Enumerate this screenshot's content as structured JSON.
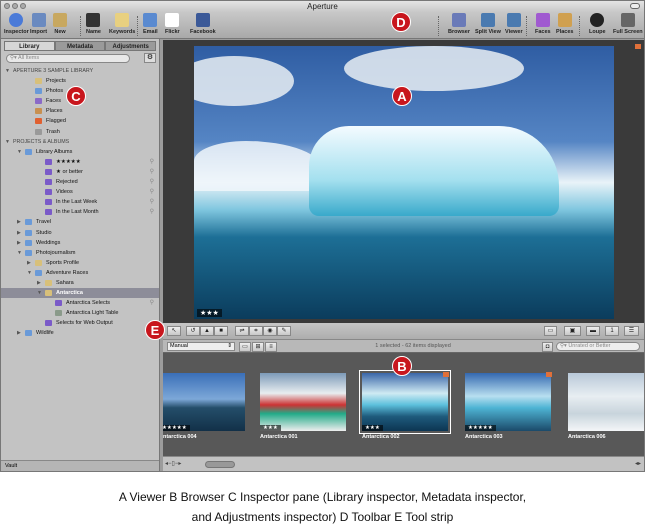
{
  "window": {
    "title": "Aperture"
  },
  "toolbar": {
    "left": [
      {
        "label": "Inspector",
        "icon": "info-icon"
      },
      {
        "label": "Import",
        "icon": "import-arrow-icon"
      },
      {
        "label": "New",
        "icon": "new-project-icon"
      },
      {
        "label": "Name",
        "icon": "name-stamp-icon"
      },
      {
        "label": "Keywords",
        "icon": "keyword-tag-icon"
      },
      {
        "label": "Email",
        "icon": "email-icon"
      },
      {
        "label": "Flickr",
        "icon": "flickr-icon"
      },
      {
        "label": "Facebook",
        "icon": "facebook-icon"
      }
    ],
    "right": [
      {
        "label": "Browser",
        "icon": "grid-icon"
      },
      {
        "label": "Split View",
        "icon": "split-view-icon"
      },
      {
        "label": "Viewer",
        "icon": "viewer-icon"
      },
      {
        "label": "Faces",
        "icon": "faces-icon"
      },
      {
        "label": "Places",
        "icon": "map-icon"
      },
      {
        "label": "Loupe",
        "icon": "loupe-icon"
      },
      {
        "label": "Full Screen",
        "icon": "full-screen-icon"
      }
    ]
  },
  "inspector": {
    "tabs": [
      "Library",
      "Metadata",
      "Adjustments"
    ],
    "search_placeholder": "All Items",
    "tree": [
      {
        "label": "APERTURE 3 SAMPLE LIBRARY",
        "level": 0,
        "type": "header",
        "tri": "▼"
      },
      {
        "label": "Projects",
        "level": 2,
        "icon": "projects-icon",
        "color": "#d8c07a"
      },
      {
        "label": "Photos",
        "level": 2,
        "icon": "photos-icon",
        "color": "#6a9ad8"
      },
      {
        "label": "Faces",
        "level": 2,
        "icon": "faces-icon",
        "color": "#8a6ac8"
      },
      {
        "label": "Places",
        "level": 2,
        "icon": "places-icon",
        "color": "#c89050"
      },
      {
        "label": "Flagged",
        "level": 2,
        "icon": "flag-icon",
        "color": "#e06030"
      },
      {
        "label": "Trash",
        "level": 2,
        "icon": "trash-icon",
        "color": "#999"
      },
      {
        "label": "PROJECTS & ALBUMS",
        "level": 0,
        "type": "header",
        "tri": "▼"
      },
      {
        "label": "Library Albums",
        "level": 1,
        "icon": "folder-icon",
        "color": "#6a9ad8",
        "tri": "▼"
      },
      {
        "label": "★★★★★",
        "level": 3,
        "icon": "smart-album-icon",
        "color": "#7a5ac8",
        "mag": true
      },
      {
        "label": "★ or better",
        "level": 3,
        "icon": "smart-album-icon",
        "color": "#7a5ac8",
        "mag": true
      },
      {
        "label": "Rejected",
        "level": 3,
        "icon": "smart-album-icon",
        "color": "#7a5ac8",
        "mag": true
      },
      {
        "label": "Videos",
        "level": 3,
        "icon": "smart-album-icon",
        "color": "#7a5ac8",
        "mag": true
      },
      {
        "label": "In the Last Week",
        "level": 3,
        "icon": "smart-album-icon",
        "color": "#7a5ac8",
        "mag": true
      },
      {
        "label": "In the Last Month",
        "level": 3,
        "icon": "smart-album-icon",
        "color": "#7a5ac8",
        "mag": true
      },
      {
        "label": "Travel",
        "level": 1,
        "icon": "folder-icon",
        "color": "#6a9ad8",
        "tri": "▶"
      },
      {
        "label": "Studio",
        "level": 1,
        "icon": "folder-icon",
        "color": "#6a9ad8",
        "tri": "▶"
      },
      {
        "label": "Weddings",
        "level": 1,
        "icon": "folder-icon",
        "color": "#6a9ad8",
        "tri": "▶"
      },
      {
        "label": "Photojournalism",
        "level": 1,
        "icon": "folder-icon",
        "color": "#6a9ad8",
        "tri": "▼"
      },
      {
        "label": "Sports Profile",
        "level": 2,
        "icon": "project-icon",
        "color": "#d8c07a",
        "tri": "▶"
      },
      {
        "label": "Adventure Races",
        "level": 2,
        "icon": "folder-icon",
        "color": "#6a9ad8",
        "tri": "▼"
      },
      {
        "label": "Sahara",
        "level": 3,
        "icon": "project-icon",
        "color": "#d8c07a",
        "tri": "▶"
      },
      {
        "label": "Antarctica",
        "level": 3,
        "icon": "project-icon",
        "color": "#d8c07a",
        "tri": "▼",
        "selected": true
      },
      {
        "label": "Antarctica Selects",
        "level": 4,
        "icon": "album-icon",
        "color": "#7a5ac8",
        "mag": true
      },
      {
        "label": "Antarctica Light Table",
        "level": 4,
        "icon": "light-table-icon",
        "color": "#8a9a8a"
      },
      {
        "label": "Selects for Web Output",
        "level": 3,
        "icon": "album-icon",
        "color": "#7a5ac8"
      },
      {
        "label": "Wildlife",
        "level": 1,
        "icon": "folder-icon",
        "color": "#6a9ad8",
        "tri": "▶"
      }
    ],
    "vault_label": "Vault"
  },
  "viewer": {
    "rating": "★★★"
  },
  "browser": {
    "sort": "Manual",
    "status": "1 selected - 62 items displayed",
    "filter_placeholder": "Unrated or Better",
    "thumbs": [
      {
        "name": "Antarctica 004",
        "rating": "★★★★★",
        "bg": "linear-gradient(#3a6fb8 0%,#7da8d8 45%,#244e6a 60%,#123048 100%)"
      },
      {
        "name": "Antarctica 001",
        "rating": "★★★",
        "bg": "linear-gradient(#7c9ab8 0%,#e8edf0 35%,#c33 55%,#2a8 70%,#eee 100%)"
      },
      {
        "name": "Antarctica 002",
        "rating": "★★★",
        "bg": "linear-gradient(#3a66a8 0%,#cfeaf3 35%,#5cc0dc 55%,#1e5a7c 75%,#0c3552 100%)",
        "selected": true,
        "flag": true
      },
      {
        "name": "Antarctica 003",
        "rating": "★★★★★",
        "bg": "linear-gradient(#3468b0 0%,#b8dff0 40%,#4eb4d4 60%,#1b4a6a 100%)",
        "flag": true
      },
      {
        "name": "Antarctica 006",
        "rating": "",
        "bg": "linear-gradient(#b8c8d8 0%,#e8eef2 40%,#c8d4dc 70%,#f4f6f8 100%)"
      }
    ]
  },
  "callouts": [
    "A",
    "B",
    "C",
    "D",
    "E"
  ],
  "caption": {
    "line1": "A Viewer  B Browser  C Inspector pane (Library inspector, Metadata inspector,",
    "line2": "and Adjustments inspector)  D Toolbar  E Tool strip"
  }
}
